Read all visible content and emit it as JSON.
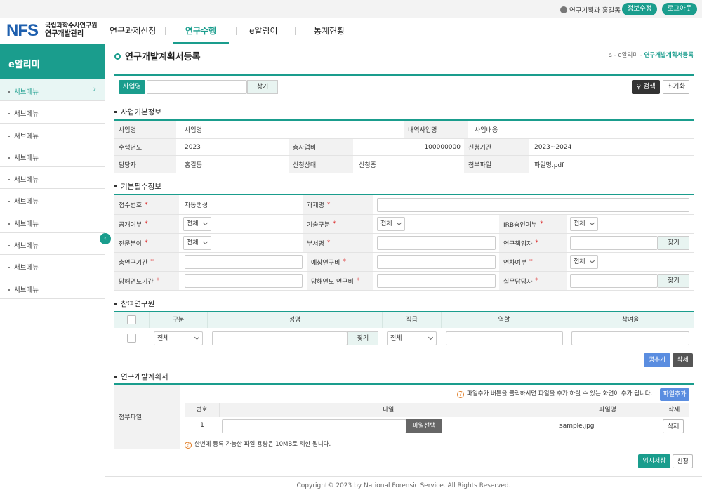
{
  "topbar": {
    "user": "연구기획과 홍길동",
    "edit_btn": "정보수정",
    "logout_btn": "로그아웃"
  },
  "logo": {
    "mark": "NFS",
    "org": "국립과학수사연구원",
    "system": "연구개발관리"
  },
  "gnb": [
    "연구과제신청",
    "연구수행",
    "e알림이",
    "통계현황"
  ],
  "sidebar": {
    "title": "e알리미",
    "items": [
      "서브메뉴",
      "서브메뉴",
      "서브메뉴",
      "서브메뉴",
      "서브메뉴",
      "서브메뉴",
      "서브메뉴",
      "서브메뉴",
      "서브메뉴",
      "서브메뉴"
    ]
  },
  "page": {
    "title": "연구개발계획서등록",
    "breadcrumb_mid": "e알리미",
    "breadcrumb_cur": "연구개발계획서등록"
  },
  "search": {
    "label": "사업명",
    "find": "찾기",
    "search_btn": "검색",
    "reset_btn": "초기화"
  },
  "basic": {
    "title": "사업기본정보",
    "r1": {
      "l1": "사업명",
      "v1": "사업명",
      "l2": "내역사업명",
      "v2": "사업내용"
    },
    "r2": {
      "l1": "수행년도",
      "v1": "2023",
      "l2": "총사업비",
      "v2": "100000000",
      "l3": "신청기간",
      "v3": "2023~2024"
    },
    "r3": {
      "l1": "담당자",
      "v1": "홍길동",
      "l2": "신청상태",
      "v2": "신청중",
      "l3": "첨부파일",
      "v3": "파일명.pdf"
    }
  },
  "required": {
    "title": "기본필수정보",
    "receipt_no": "접수번호",
    "receipt_val": "자동생성",
    "task_name": "과제명",
    "public": "공개여부",
    "tech": "기술구분",
    "irb": "IRB승인여부",
    "field": "전문분야",
    "dept": "부서명",
    "pi": "연구책임자",
    "period": "총연구기간",
    "budget": "예상연구비",
    "delay": "연차여부",
    "year_period": "당해연도기간",
    "year_budget": "당해연도 연구비",
    "manager": "실무담당자",
    "all": "전체",
    "find": "찾기"
  },
  "researchers": {
    "title": "참여연구원",
    "headers": [
      "구분",
      "성명",
      "직급",
      "역할",
      "참여율"
    ],
    "all": "전체",
    "find": "찾기",
    "add_row": "행추가",
    "delete": "삭제"
  },
  "plan": {
    "title": "연구개발계획서",
    "label": "첨부파일",
    "notice": "파일추가 버튼을 클릭하시면 파일을 추가 하실 수 있는 화면이 추가 됩니다.",
    "add_file": "파일추가",
    "headers": [
      "번호",
      "파일",
      "파일명",
      "삭제"
    ],
    "row_no": "1",
    "choose": "파일선택",
    "filename": "sample.jpg",
    "delete": "삭제",
    "limit": "한번에 등록 가능한 파일 용량은 10MB로 제한 됩니다."
  },
  "actions": {
    "temp_save": "임시저장",
    "apply": "신청"
  },
  "footer": "Copyright© 2023 by National Forensic Service. All Rights Reserved.",
  "colors": {
    "accent": "#1a9d8d",
    "navy": "#1e5fae",
    "blue_btn": "#5a8de0",
    "dark_btn": "#555555"
  }
}
